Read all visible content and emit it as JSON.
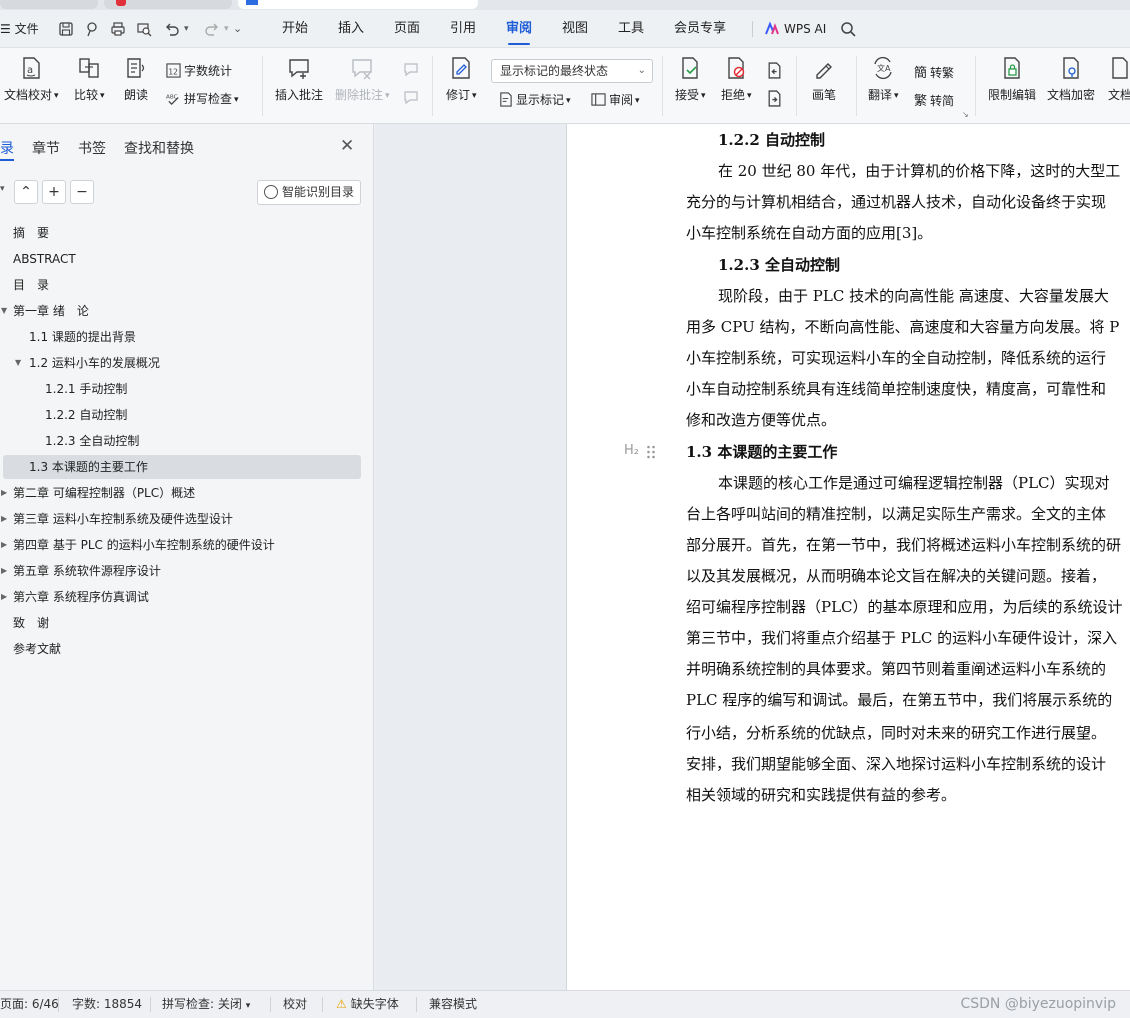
{
  "menubar": {
    "file": "文件",
    "tabs": [
      "开始",
      "插入",
      "页面",
      "引用",
      "审阅",
      "视图",
      "工具",
      "会员专享"
    ],
    "active_tab": "审阅",
    "wps_ai": "WPS AI"
  },
  "ribbon": {
    "doc_proofread": "文档校对",
    "compare": "比较",
    "read_aloud": "朗读",
    "word_count": "字数统计",
    "spell_check": "拼写检查",
    "insert_comment": "插入批注",
    "delete_comment": "删除批注",
    "track_changes": "修订",
    "markup_state": "显示标记的最终状态",
    "show_markup": "显示标记",
    "review": "审阅",
    "accept": "接受",
    "reject": "拒绝",
    "ink": "画笔",
    "translate": "翻译",
    "to_traditional": "转繁",
    "to_simplified": "转简",
    "restrict_editing": "限制编辑",
    "encrypt_doc": "文档加密",
    "doc_more": "文档"
  },
  "nav": {
    "tabs": [
      "录",
      "章节",
      "书签",
      "查找和替换"
    ],
    "smart_toc": "智能识别目录",
    "items": [
      {
        "label": "摘　要"
      },
      {
        "label": "ABSTRACT"
      },
      {
        "label": "目　录"
      },
      {
        "label": "第一章  绪　论"
      },
      {
        "label": "1.1  课题的提出背景"
      },
      {
        "label": "1.2  运料小车的发展概况"
      },
      {
        "label": "1.2.1 手动控制"
      },
      {
        "label": "1.2.2 自动控制"
      },
      {
        "label": "1.2.3 全自动控制"
      },
      {
        "label": "1.3  本课题的主要工作"
      },
      {
        "label": "第二章  可编程控制器（PLC）概述"
      },
      {
        "label": "第三章  运料小车控制系统及硬件选型设计"
      },
      {
        "label": "第四章  基于 PLC 的运料小车控制系统的硬件设计"
      },
      {
        "label": "第五章  系统软件源程序设计"
      },
      {
        "label": "第六章  系统程序仿真调试"
      },
      {
        "label": "致　谢"
      },
      {
        "label": "参考文献"
      }
    ]
  },
  "document": {
    "lines": [
      "1.2.2 自动控制",
      "在 20 世纪 80 年代，由于计算机的价格下降，这时的大型工",
      "充分的与计算机相结合，通过机器人技术，自动化设备终于实现",
      "小车控制系统在自动方面的应用[3]。",
      "1.2.3 全自动控制",
      "现阶段，由于 PLC 技术的向高性能  高速度、大容量发展大",
      "用多 CPU 结构，不断向高性能、高速度和大容量方向发展。将 P",
      "小车控制系统，可实现运料小车的全自动控制，降低系统的运行",
      "小车自动控制系统具有连线简单控制速度快，精度高，可靠性和",
      "修和改造方便等优点。",
      "1.3  本课题的主要工作",
      "本课题的核心工作是通过可编程逻辑控制器（PLC）实现对",
      "台上各呼叫站间的精准控制，以满足实际生产需求。全文的主体",
      "部分展开。首先，在第一节中，我们将概述运料小车控制系统的研",
      "以及其发展概况，从而明确本论文旨在解决的关键问题。接着，",
      "绍可编程序控制器（PLC）的基本原理和应用，为后续的系统设计",
      "第三节中，我们将重点介绍基于 PLC 的运料小车硬件设计，深入",
      "并明确系统控制的具体要求。第四节则着重阐述运料小车系统的",
      "PLC 程序的编写和调试。最后，在第五节中，我们将展示系统的",
      "行小结，分析系统的优缺点，同时对未来的研究工作进行展望。",
      "安排，我们期望能够全面、深入地探讨运料小车控制系统的设计",
      "相关领域的研究和实践提供有益的参考。"
    ],
    "heading_marker": "H₂"
  },
  "status": {
    "page": "页面: 6/46",
    "words": "字数: 18854",
    "spell": "拼写检查: 关闭",
    "proof": "校对",
    "missing_font": "缺失字体",
    "compat": "兼容模式",
    "watermark": "CSDN @biyezuopinvip"
  }
}
